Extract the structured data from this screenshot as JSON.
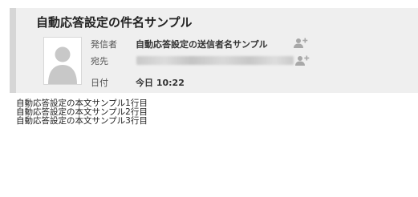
{
  "email": {
    "subject": "自動応答設定の件名サンプル",
    "from": {
      "label": "発信者",
      "name": "自動応答設定の送信者名サンプル"
    },
    "to": {
      "label": "宛先",
      "address_obscured": true
    },
    "date": {
      "label": "日付",
      "value": "今日 10:22"
    },
    "body_lines": [
      "自動応答設定の本文サンプル1行目",
      "自動応答設定の本文サンプル2行目",
      "自動応答設定の本文サンプル3行目"
    ]
  },
  "icons": {
    "avatar": "avatar-placeholder-icon",
    "add_contact": "add-contact-icon"
  },
  "colors": {
    "header_background": "#efefef",
    "header_left_bar": "#d6d6d6",
    "text_primary": "#222222",
    "icon_gray": "#a8a8a8"
  }
}
